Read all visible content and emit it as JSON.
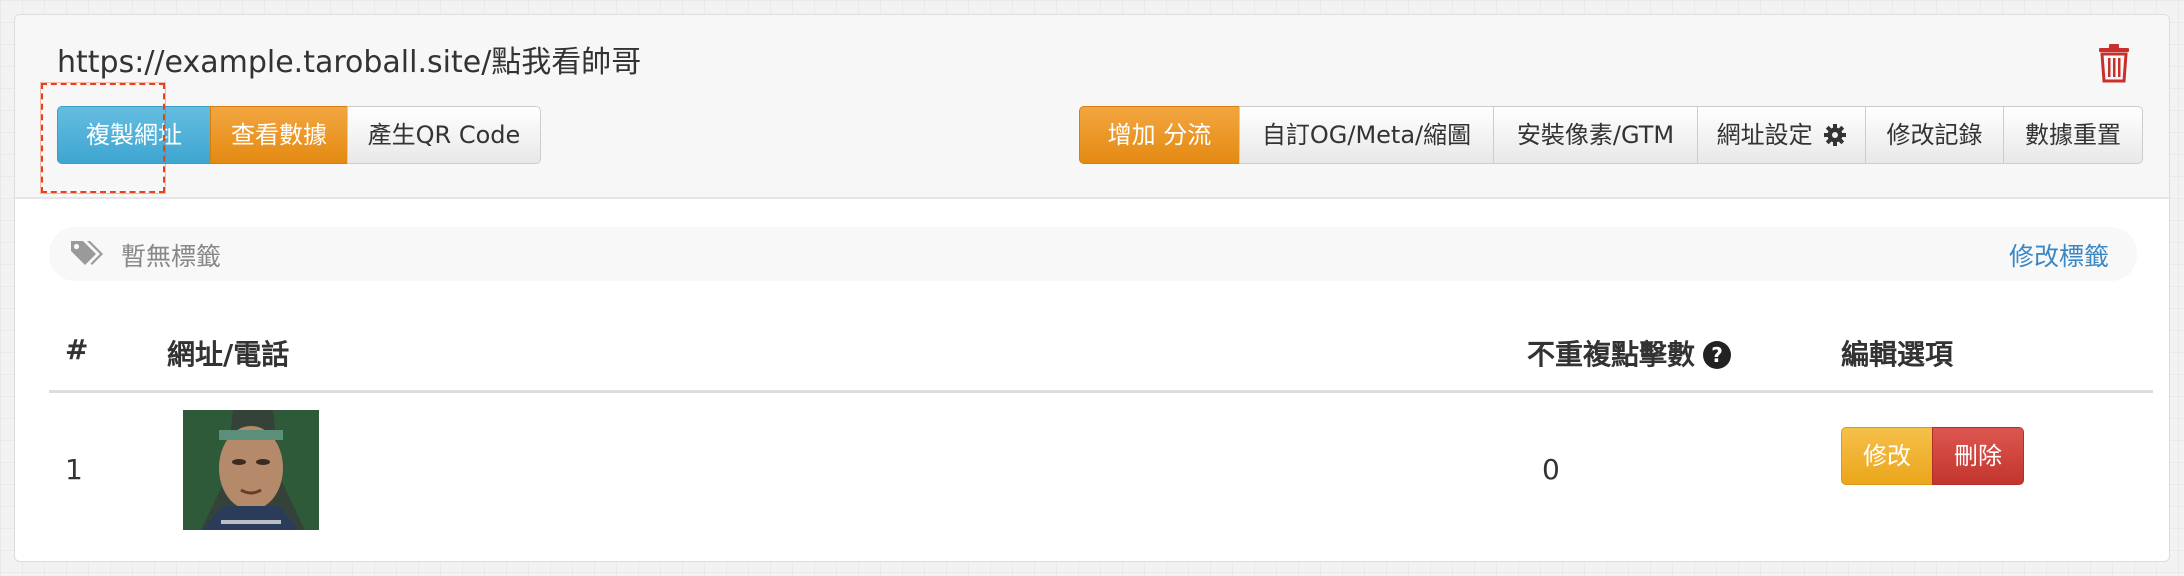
{
  "header": {
    "short_url": "https://example.taroball.site/點我看帥哥",
    "delete_icon": "trash-icon"
  },
  "left_actions": {
    "copy_url": "複製網址",
    "view_stats": "查看數據",
    "make_qr": "產生QR Code"
  },
  "right_actions": {
    "add_split": "增加 分流",
    "custom_og": "自訂OG/Meta/縮圖",
    "install_pixel": "安裝像素/GTM",
    "url_settings": "網址設定",
    "url_settings_icon": "gear-icon",
    "edit_history": "修改記錄",
    "reset_stats": "數據重置"
  },
  "tags": {
    "icon": "tags-icon",
    "empty_text": "暫無標籤",
    "edit_link": "修改標籤"
  },
  "table": {
    "columns": [
      "#",
      "網址/電話",
      "不重複點擊數",
      "編輯選項"
    ],
    "rows": [
      {
        "index": "1",
        "unique_clicks": "0",
        "edit_label": "修改",
        "delete_label": "刪除"
      }
    ]
  },
  "colors": {
    "info": "#3ea6d1",
    "warning": "#e48a12",
    "danger": "#c2352d",
    "link": "#3a87c4",
    "trash": "#c9302c",
    "annotation": "#e8421c"
  }
}
